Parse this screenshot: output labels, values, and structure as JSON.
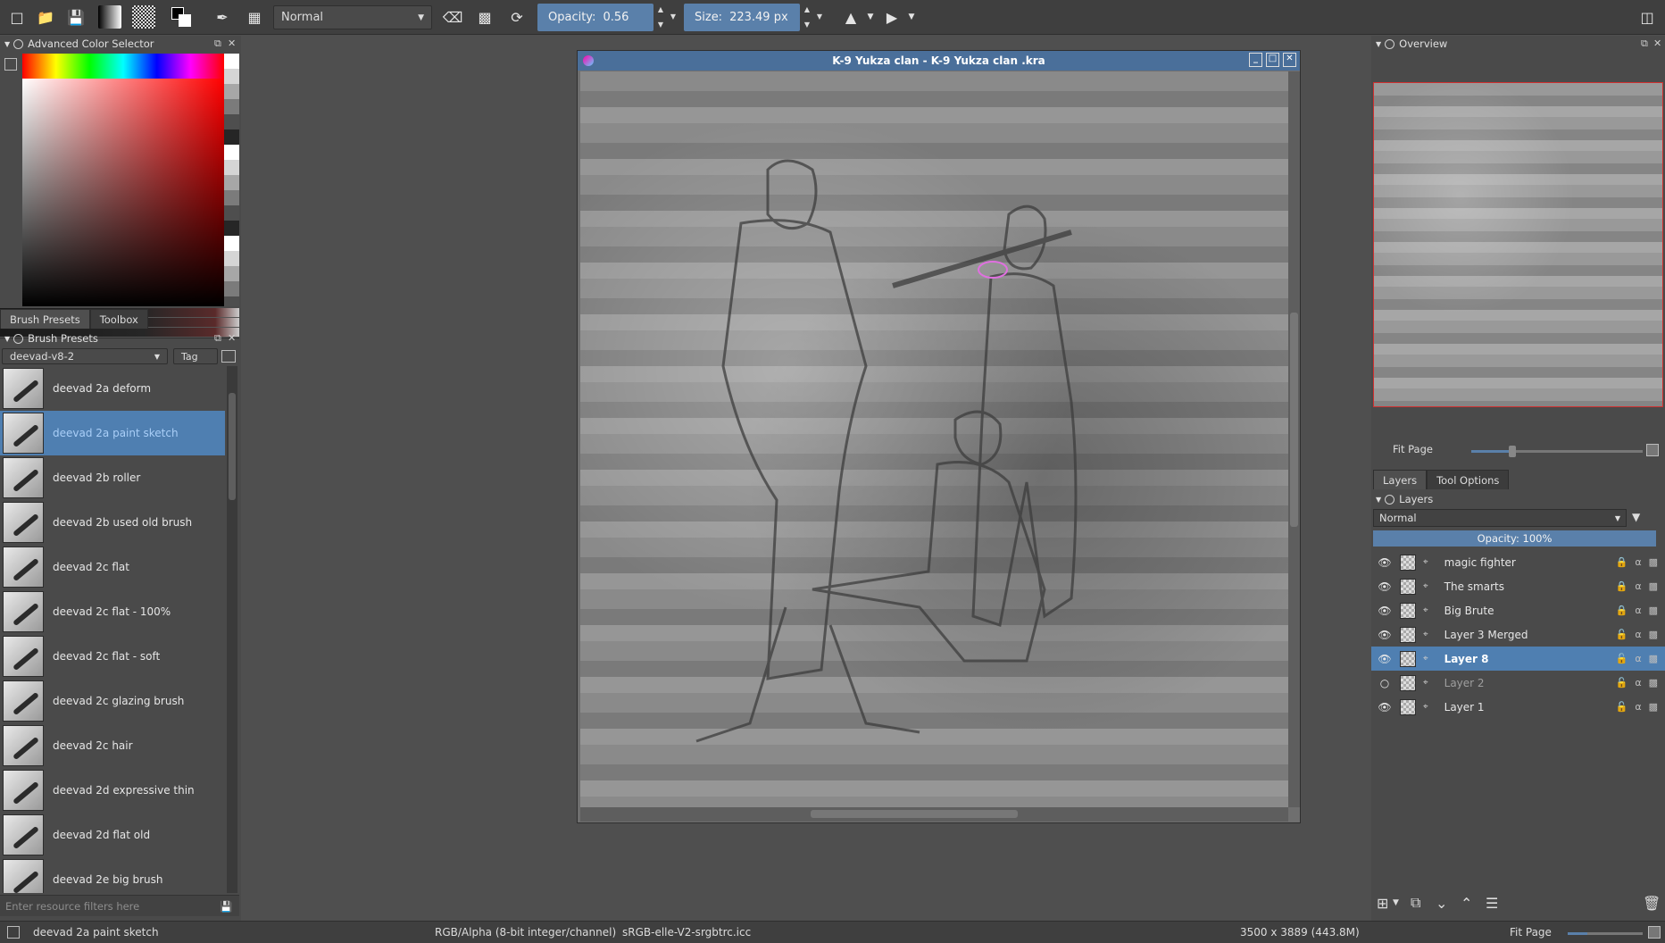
{
  "toolbar": {
    "blend_mode": "Normal",
    "opacity_label": "Opacity:",
    "opacity_value": "0.56",
    "size_label": "Size:",
    "size_value": "223.49 px"
  },
  "left": {
    "color_selector_title": "Advanced Color Selector",
    "tabs": [
      "Brush Presets",
      "Toolbox"
    ],
    "brush_presets_title": "Brush Presets",
    "preset_set": "deevad-v8-2",
    "tag_label": "Tag",
    "brushes": [
      "deevad 2a deform",
      "deevad 2a paint sketch",
      "deevad 2b roller",
      "deevad 2b used old brush",
      "deevad 2c flat",
      "deevad 2c flat - 100%",
      "deevad 2c flat - soft",
      "deevad 2c glazing brush",
      "deevad 2c hair",
      "deevad 2d expressive thin",
      "deevad 2d flat old",
      "deevad 2e big brush"
    ],
    "selected_brush_index": 1,
    "filter_placeholder": "Enter resource filters here"
  },
  "canvas": {
    "title": "K-9 Yukza clan  - K-9 Yukza clan .kra"
  },
  "right": {
    "overview_title": "Overview",
    "fit_page_label": "Fit Page",
    "tabs": [
      "Layers",
      "Tool Options"
    ],
    "layers_title": "Layers",
    "layer_blend": "Normal",
    "layer_opacity": "Opacity:  100%",
    "layers": [
      {
        "name": "magic fighter",
        "visible": true,
        "locked": true
      },
      {
        "name": "The smarts",
        "visible": true,
        "locked": true
      },
      {
        "name": "Big Brute",
        "visible": true,
        "locked": true
      },
      {
        "name": "Layer 3 Merged",
        "visible": true,
        "locked": false
      },
      {
        "name": "Layer 8",
        "visible": true,
        "locked": false,
        "selected": true
      },
      {
        "name": "Layer 2",
        "visible": false,
        "locked": false
      },
      {
        "name": "Layer 1",
        "visible": true,
        "locked": false
      }
    ]
  },
  "status": {
    "brush": "deevad 2a paint sketch",
    "color_space": "RGB/Alpha (8-bit integer/channel)",
    "profile": "sRGB-elle-V2-srgbtrc.icc",
    "dimensions": "3500 x 3889 (443.8M)",
    "zoom_label": "Fit Page"
  },
  "colors": {
    "accent": "#5a80aa",
    "selection": "#4f7fb1",
    "panel": "#4a4a4a",
    "toolbar": "#3f3f3f"
  }
}
